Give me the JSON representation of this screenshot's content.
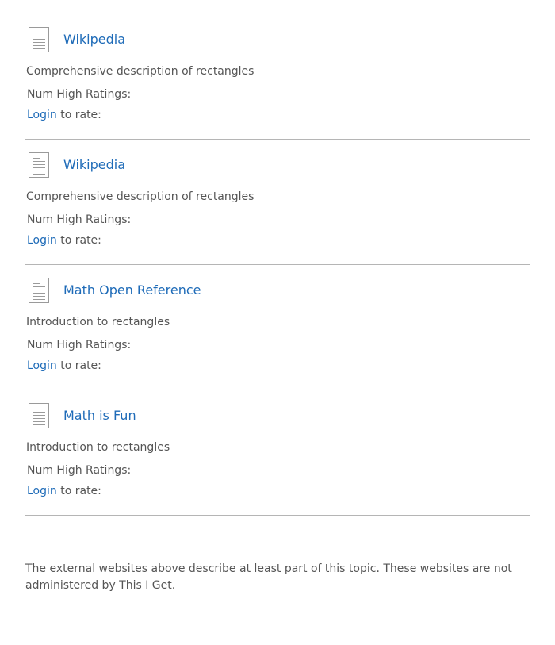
{
  "resources": [
    {
      "icon": "document-icon",
      "title": "Wikipedia",
      "description": "Comprehensive description of rectangles",
      "ratings_label": "Num High Ratings:",
      "login_label": "Login",
      "rate_suffix": " to rate:"
    },
    {
      "icon": "document-icon",
      "title": "Wikipedia",
      "description": "Comprehensive description of rectangles",
      "ratings_label": "Num High Ratings:",
      "login_label": "Login",
      "rate_suffix": " to rate:"
    },
    {
      "icon": "document-icon",
      "title": "Math Open Reference",
      "description": "Introduction to rectangles",
      "ratings_label": "Num High Ratings:",
      "login_label": "Login",
      "rate_suffix": " to rate:"
    },
    {
      "icon": "document-icon",
      "title": "Math is Fun",
      "description": "Introduction to rectangles",
      "ratings_label": "Num High Ratings:",
      "login_label": "Login",
      "rate_suffix": " to rate:"
    }
  ],
  "footer": {
    "note": "The external websites above describe at least part of this topic. These websites are not administered by This I Get."
  },
  "colors": {
    "link": "#1e6bb8",
    "text": "#555555",
    "rule": "#b5b5b5"
  }
}
